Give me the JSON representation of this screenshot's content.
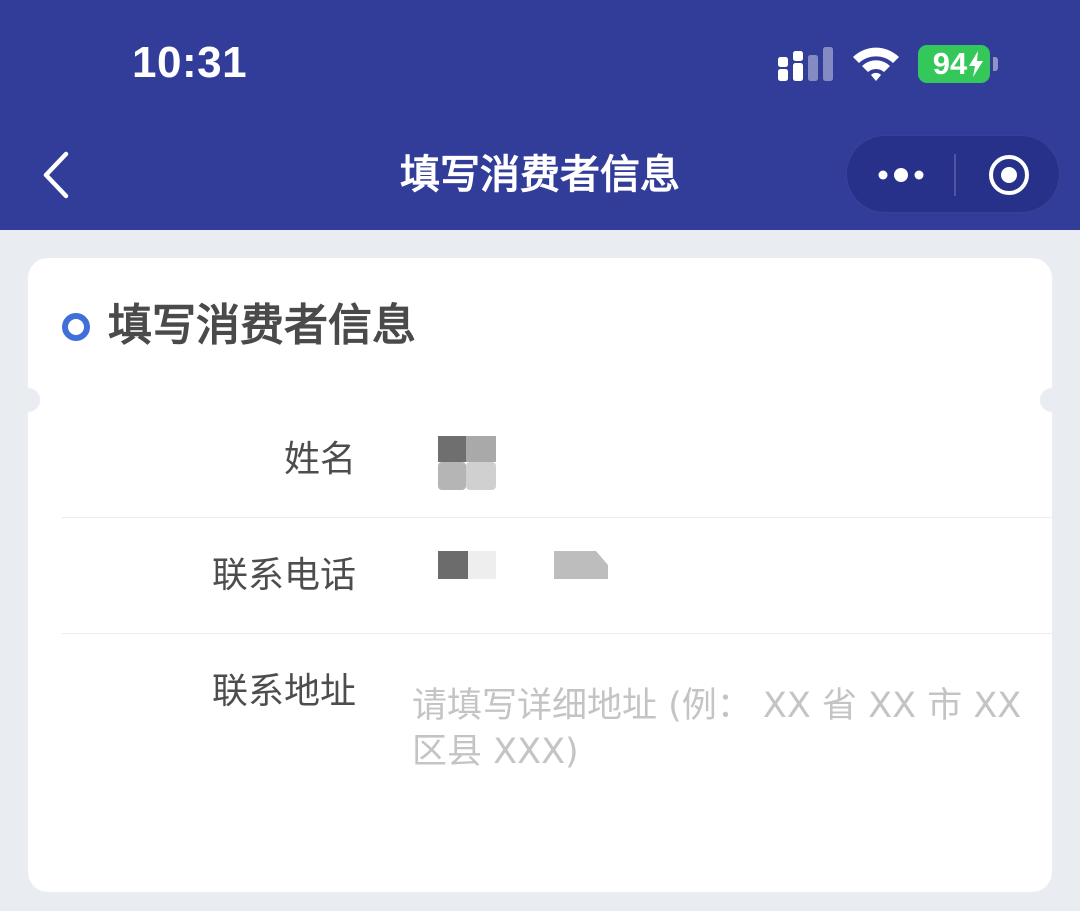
{
  "status_bar": {
    "time": "10:31",
    "battery_level": "94",
    "icons": [
      "signal-icon",
      "wifi-icon",
      "battery-charging-icon"
    ]
  },
  "nav": {
    "title": "填写消费者信息",
    "back_icon": "chevron-left-icon",
    "more_icon": "more-dots-icon",
    "close_icon": "target-circle-icon"
  },
  "form": {
    "section_title": "填写消费者信息",
    "fields": [
      {
        "label": "姓名",
        "value_redacted": true
      },
      {
        "label": "联系电话",
        "value_redacted": true
      },
      {
        "label": "联系地址",
        "placeholder": "请填写详细地址 (例： XX 省 XX 市 XX 区县 XXX)"
      }
    ]
  },
  "colors": {
    "header": "#323d9a",
    "accent": "#3f6fd8",
    "battery": "#34c759",
    "background": "#e9ecf1"
  }
}
